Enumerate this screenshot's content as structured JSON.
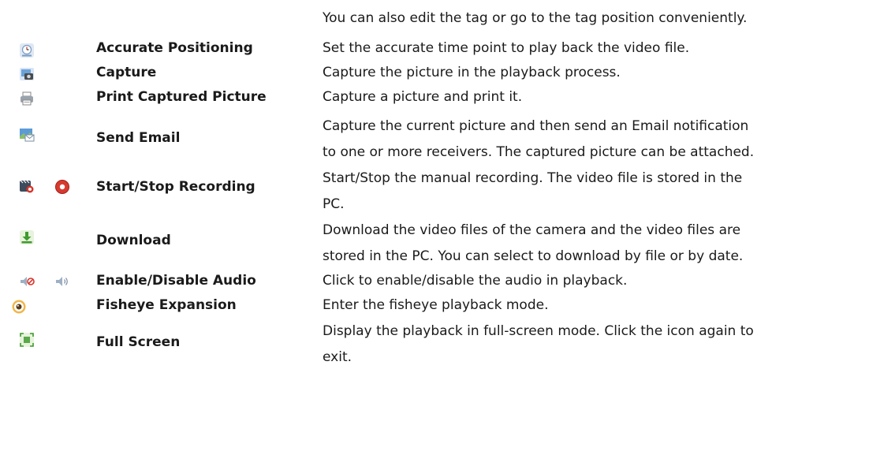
{
  "intro_line": "You can also edit the tag or go to the tag position conveniently.",
  "rows": [
    {
      "icons": [
        "clock-positioning-icon"
      ],
      "name": "Accurate Positioning",
      "desc": [
        "Set the accurate time point to play back the video file."
      ]
    },
    {
      "icons": [
        "camera-capture-icon"
      ],
      "name": "Capture",
      "desc": [
        "Capture the picture in the playback process."
      ]
    },
    {
      "icons": [
        "printer-icon"
      ],
      "name": "Print Captured Picture",
      "desc": [
        "Capture a picture and print it."
      ]
    },
    {
      "icons": [
        "picture-email-icon"
      ],
      "name": "Send Email",
      "desc": [
        "Capture the current picture and then send an Email notification",
        "to one or more receivers. The captured picture can be attached."
      ]
    },
    {
      "icons": [
        "record-clapper-icon",
        "record-button-icon"
      ],
      "name": "Start/Stop Recording",
      "desc": [
        "Start/Stop the manual recording. The video file is stored in the",
        "PC."
      ]
    },
    {
      "icons": [
        "download-icon"
      ],
      "name": "Download",
      "desc": [
        "Download the video files of the camera and the video files are",
        "stored in the PC. You can select to download by file or by date."
      ]
    },
    {
      "icons": [
        "audio-muted-icon",
        "audio-on-icon"
      ],
      "name": "Enable/Disable Audio",
      "desc": [
        "Click to enable/disable the audio in playback."
      ]
    },
    {
      "icons": [
        "fisheye-icon"
      ],
      "name": "Fisheye Expansion",
      "desc": [
        "Enter the fisheye playback mode."
      ]
    },
    {
      "icons": [
        "fullscreen-icon"
      ],
      "name": "Full Screen",
      "desc": [
        "Display the playback in full-screen mode. Click the icon again to",
        "exit."
      ]
    }
  ]
}
